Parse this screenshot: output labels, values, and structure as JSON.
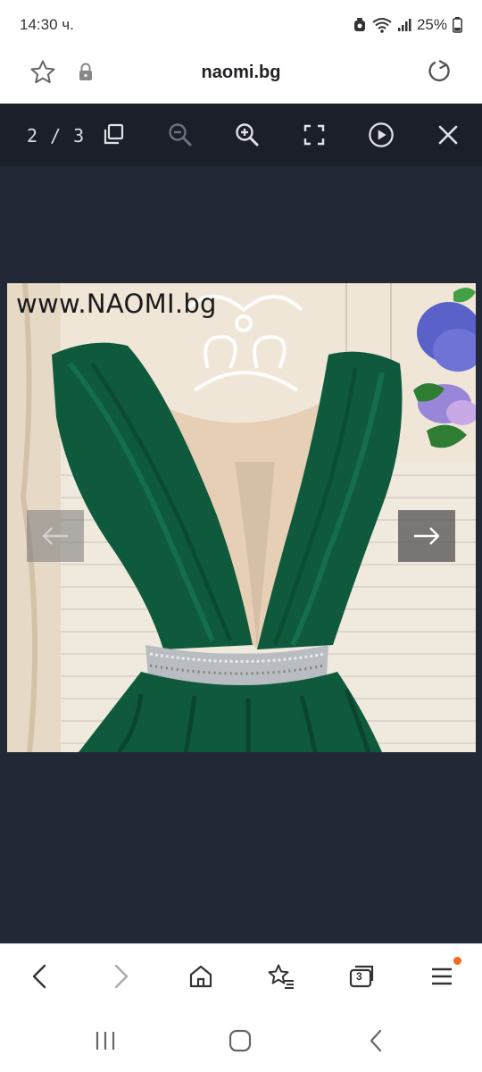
{
  "status": {
    "time": "14:30 ч.",
    "battery": "25%"
  },
  "browser": {
    "domain": "naomi.bg"
  },
  "viewer": {
    "counter": "2 / 3",
    "watermark": "www.NAOMI.bg"
  },
  "bottom_nav": {
    "tab_count": "3"
  },
  "colors": {
    "accent": "#f26b1d",
    "viewer_bg": "#232837",
    "toolbar_bg": "#1b1f2a",
    "dress_green": "#0f5a3c"
  }
}
